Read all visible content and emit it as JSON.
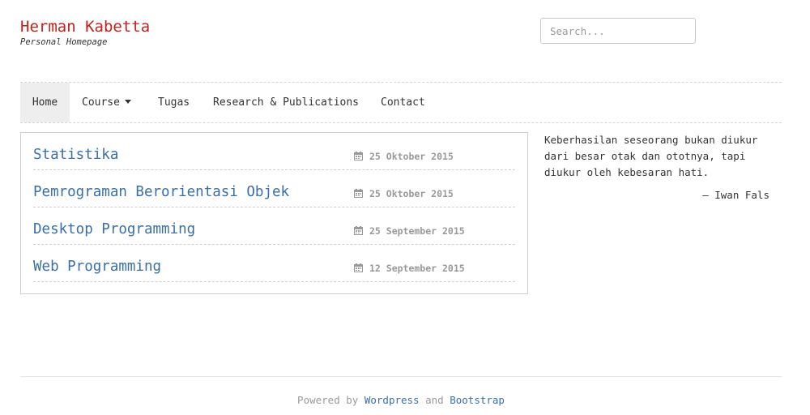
{
  "header": {
    "site_title": "Herman Kabetta",
    "tagline": "Personal Homepage",
    "search_placeholder": "Search..."
  },
  "nav": {
    "items": [
      {
        "label": "Home",
        "active": true
      },
      {
        "label": "Course",
        "dropdown": true
      },
      {
        "label": "Tugas"
      },
      {
        "label": "Research & Publications"
      },
      {
        "label": "Contact"
      }
    ]
  },
  "posts": [
    {
      "title": "Statistika",
      "date": "25 Oktober 2015"
    },
    {
      "title": "Pemrograman Berorientasi Objek",
      "date": "25 Oktober 2015"
    },
    {
      "title": "Desktop Programming",
      "date": "25 September 2015"
    },
    {
      "title": "Web Programming",
      "date": "12 September 2015"
    }
  ],
  "sidebar": {
    "quote": "Keberhasilan seseorang bukan diukur dari besar otak dan ototnya, tapi diukur oleh kebesaran hati.",
    "author": "— Iwan Fals"
  },
  "footer": {
    "powered_by": "Powered by",
    "link1": "Wordpress",
    "and": "and",
    "link2": "Bootstrap"
  },
  "colors": {
    "title": "#c0231e",
    "link": "#3a6fa5",
    "muted": "#999999",
    "nav_active_bg": "#eeeeee"
  },
  "icons": {
    "date": "calendar-icon",
    "dropdown": "caret-down-icon"
  }
}
